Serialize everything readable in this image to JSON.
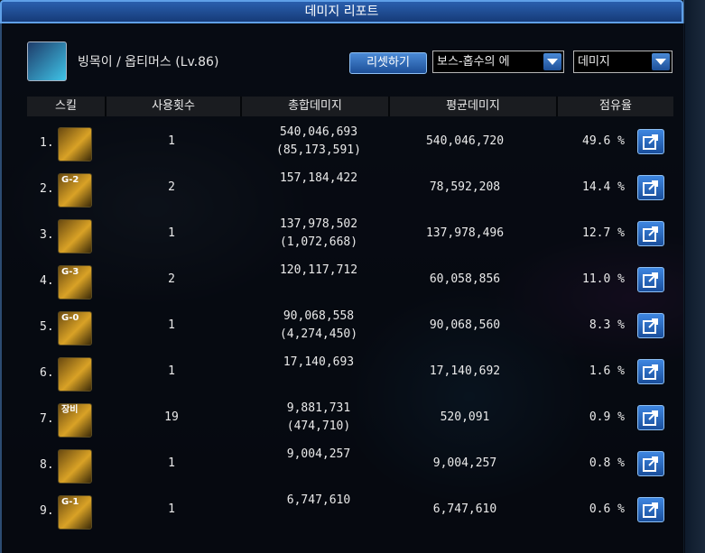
{
  "window": {
    "title": "데미지 리포트"
  },
  "character": {
    "label": "빙목이 / 옵티머스 (Lv.86)"
  },
  "toolbar": {
    "reset_label": "리셋하기",
    "target_dropdown": "보스-홉수의 에",
    "metric_dropdown": "데미지"
  },
  "columns": {
    "skill": "스킬",
    "use_count": "사용횟수",
    "total_damage": "총합데미지",
    "avg_damage": "평균데미지",
    "share": "점유율"
  },
  "rows": [
    {
      "rank": "1.",
      "icon_label": "",
      "uses": "1",
      "total": "540,046,693",
      "total_sub": "(85,173,591)",
      "avg": "540,046,720",
      "share": "49.6 %"
    },
    {
      "rank": "2.",
      "icon_label": "G-2",
      "uses": "2",
      "total": "157,184,422",
      "total_sub": "",
      "avg": "78,592,208",
      "share": "14.4 %"
    },
    {
      "rank": "3.",
      "icon_label": "",
      "uses": "1",
      "total": "137,978,502",
      "total_sub": "(1,072,668)",
      "avg": "137,978,496",
      "share": "12.7 %"
    },
    {
      "rank": "4.",
      "icon_label": "G-3",
      "uses": "2",
      "total": "120,117,712",
      "total_sub": "",
      "avg": "60,058,856",
      "share": "11.0 %"
    },
    {
      "rank": "5.",
      "icon_label": "G-0",
      "uses": "1",
      "total": "90,068,558",
      "total_sub": "(4,274,450)",
      "avg": "90,068,560",
      "share": "8.3 %"
    },
    {
      "rank": "6.",
      "icon_label": "",
      "uses": "1",
      "total": "17,140,693",
      "total_sub": "",
      "avg": "17,140,692",
      "share": "1.6 %"
    },
    {
      "rank": "7.",
      "icon_label": "장비",
      "uses": "19",
      "total": "9,881,731",
      "total_sub": "(474,710)",
      "avg": "520,091",
      "share": "0.9 %"
    },
    {
      "rank": "8.",
      "icon_label": "",
      "uses": "1",
      "total": "9,004,257",
      "total_sub": "",
      "avg": "9,004,257",
      "share": "0.8 %"
    },
    {
      "rank": "9.",
      "icon_label": "G-1",
      "uses": "1",
      "total": "6,747,610",
      "total_sub": "",
      "avg": "6,747,610",
      "share": "0.6 %"
    }
  ]
}
